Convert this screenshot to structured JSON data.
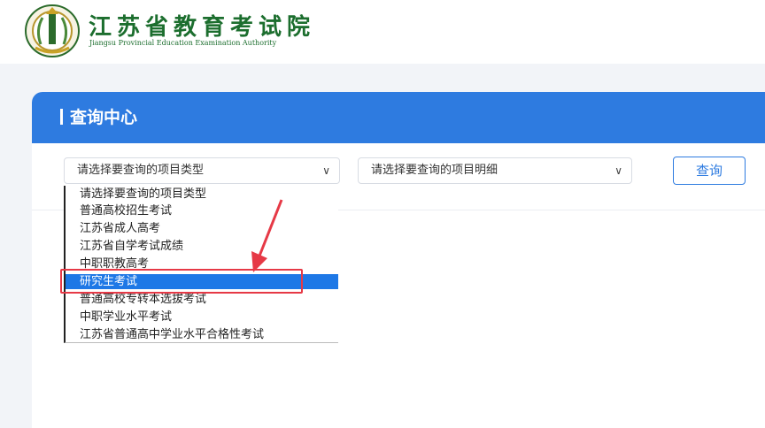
{
  "header": {
    "org_name_cn": "江苏省教育考试院",
    "org_name_en": "Jiangsu Provincial Education Examination Authority"
  },
  "panel": {
    "title": "查询中心"
  },
  "filters": {
    "type_select_value": "请选择要查询的项目类型",
    "detail_select_value": "请选择要查询的项目明细",
    "query_button": "查询"
  },
  "dropdown": {
    "options": [
      "请选择要查询的项目类型",
      "普通高校招生考试",
      "江苏省成人高考",
      "江苏省自学考试成绩",
      "中职职教高考",
      "研究生考试",
      "普通高校专转本选拔考试",
      "中职学业水平考试",
      "江苏省普通高中学业水平合格性考试"
    ],
    "selected_index": 5
  },
  "colors": {
    "accent": "#2e7be0",
    "logo_green": "#1c6e2e",
    "highlight_red": "#e63946",
    "selected_bg": "#1e78e6"
  },
  "icons": {
    "emblem": "school-emblem-icon",
    "chevron": "chevron-down-icon",
    "annotation": "arrow-annotation-icon"
  }
}
